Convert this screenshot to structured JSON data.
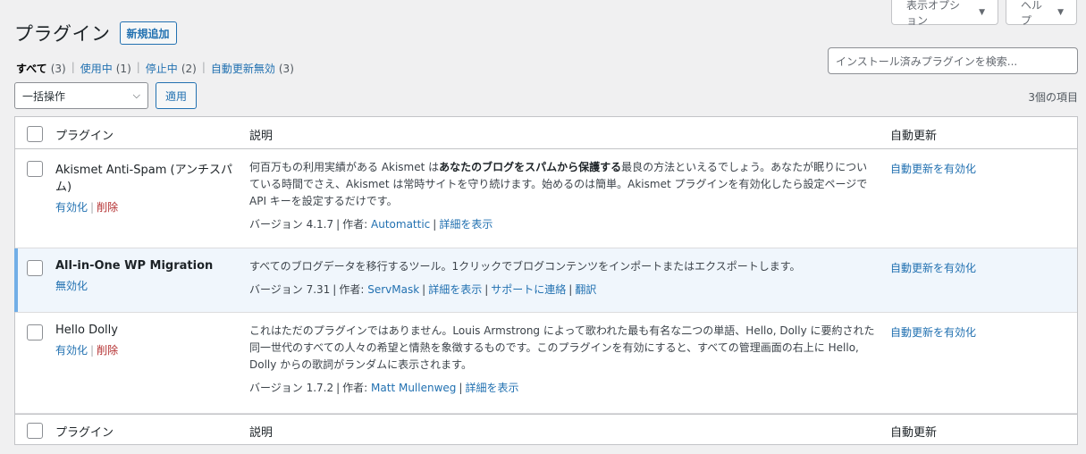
{
  "screen_options": {
    "options_label": "表示オプション",
    "help_label": "ヘルプ"
  },
  "header": {
    "title": "プラグイン",
    "add_new": "新規追加"
  },
  "filters": [
    {
      "label": "すべて",
      "count": "(3)"
    },
    {
      "label": "使用中",
      "count": "(1)"
    },
    {
      "label": "停止中",
      "count": "(2)"
    },
    {
      "label": "自動更新無効",
      "count": "(3)"
    }
  ],
  "search": {
    "placeholder": "インストール済みプラグインを検索..."
  },
  "bulk": {
    "select_value": "一括操作",
    "apply": "適用"
  },
  "item_count": "3個の項目",
  "columns": {
    "plugin": "プラグイン",
    "description": "説明",
    "auto_update": "自動更新"
  },
  "plugins": [
    {
      "name": "Akismet Anti-Spam (アンチスパム)",
      "action1": "有効化",
      "action2": "削除",
      "desc_pre": "何百万もの利用実績がある Akismet は",
      "desc_bold": "あなたのブログをスパムから保護する",
      "desc_post": "最良の方法といえるでしょう。あなたが眠りについている時間でさえ、Akismet は常時サイトを守り続けます。始めるのは簡単。Akismet プラグインを有効化したら設定ページで API キーを設定するだけです。",
      "version": "バージョン 4.1.7",
      "author_label": "作者:",
      "author": "Automattic",
      "details": "詳細を表示",
      "auto_update": "自動更新を有効化"
    },
    {
      "name": "All-in-One WP Migration",
      "action1": "無効化",
      "desc": "すべてのブログデータを移行するツール。1クリックでブログコンテンツをインポートまたはエクスポートします。",
      "version": "バージョン 7.31",
      "author_label": "作者:",
      "author": "ServMask",
      "details": "詳細を表示",
      "support": "サポートに連絡",
      "translate": "翻訳",
      "auto_update": "自動更新を有効化"
    },
    {
      "name": "Hello Dolly",
      "action1": "有効化",
      "action2": "削除",
      "desc": "これはただのプラグインではありません。Louis Armstrong によって歌われた最も有名な二つの単語、Hello, Dolly に要約された同一世代のすべての人々の希望と情熱を象徴するものです。このプラグインを有効にすると、すべての管理画面の右上に Hello, Dolly からの歌詞がランダムに表示されます。",
      "version": "バージョン 1.7.2",
      "author_label": "作者:",
      "author": "Matt Mullenweg",
      "details": "詳細を表示",
      "auto_update": "自動更新を有効化"
    }
  ],
  "colors": {
    "link": "#2271b1",
    "delete": "#b32d2e",
    "active_bar": "#72aee6"
  }
}
